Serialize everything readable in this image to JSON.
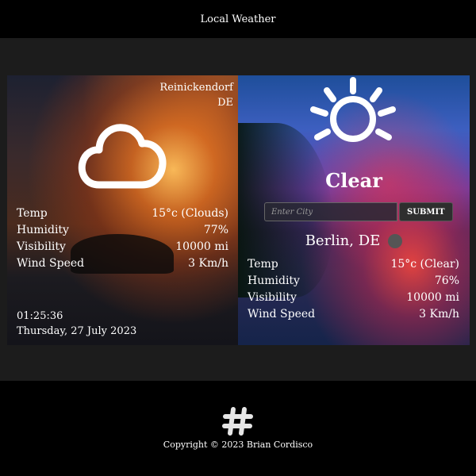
{
  "header": {
    "title": "Local Weather"
  },
  "left_card": {
    "location": {
      "city": "Reinickendorf",
      "country": "DE"
    },
    "icon": "cloud-icon",
    "stats": [
      {
        "label": "Temp",
        "value": "15°c (Clouds)"
      },
      {
        "label": "Humidity",
        "value": "77%"
      },
      {
        "label": "Visibility",
        "value": "10000 mi"
      },
      {
        "label": "Wind Speed",
        "value": "3 Km/h"
      }
    ],
    "time": "01:25:36",
    "date": "Thursday, 27 July 2023"
  },
  "right_card": {
    "icon": "sun-icon",
    "condition": "Clear",
    "search": {
      "placeholder": "Enter City",
      "button_label": "SUBMIT"
    },
    "city": "Berlin, DE",
    "stats": [
      {
        "label": "Temp",
        "value": "15°c (Clear)"
      },
      {
        "label": "Humidity",
        "value": "76%"
      },
      {
        "label": "Visibility",
        "value": "10000 mi"
      },
      {
        "label": "Wind Speed",
        "value": "3 Km/h"
      }
    ]
  },
  "footer": {
    "icon": "hashtag-icon",
    "copyright": "Copyright © 2023 Brian Cordisco"
  },
  "colors": {
    "header_bg": "#000000",
    "page_bg": "#1c1c1c",
    "footer_bg": "#000000",
    "status_dot": "#555555"
  }
}
